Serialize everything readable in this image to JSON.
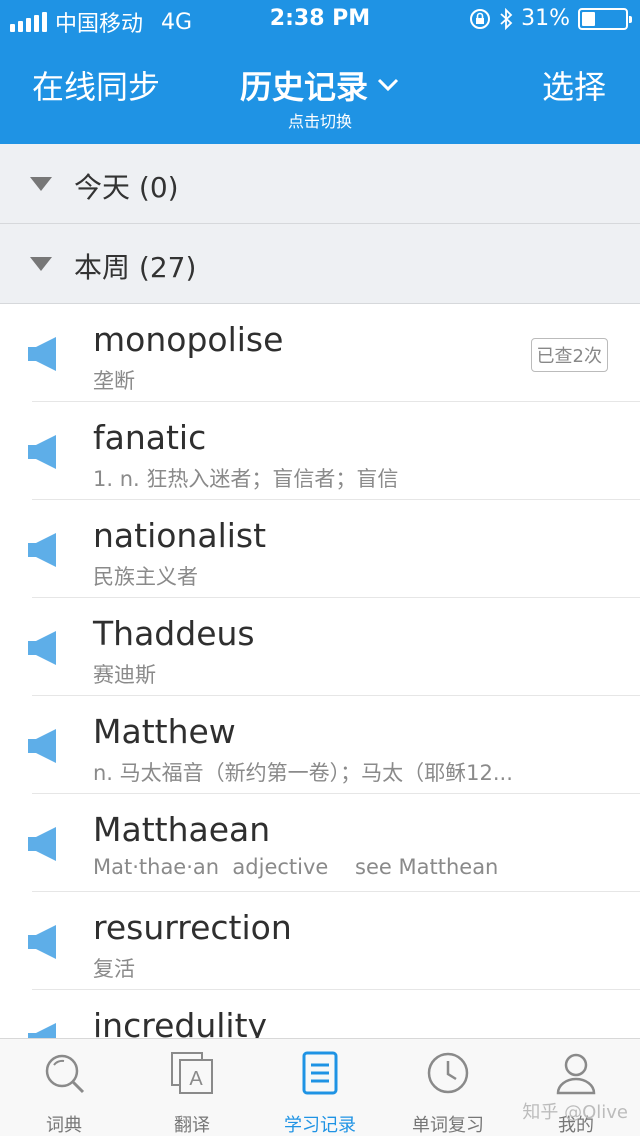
{
  "status": {
    "carrier": "中国移动",
    "network": "4G",
    "time": "2:38 PM",
    "battery_text": "31%",
    "battery_level": 0.31
  },
  "nav": {
    "left": "在线同步",
    "title": "历史记录",
    "subtitle": "点击切换",
    "right": "选择"
  },
  "sections": {
    "today": "今天 (0)",
    "week": "本周 (27)"
  },
  "entries": [
    {
      "word": "monopolise",
      "def": "垄断",
      "badge": "已查2次"
    },
    {
      "word": "fanatic",
      "def": "1. n. 狂热入迷者；盲信者；盲信"
    },
    {
      "word": "nationalist",
      "def": "民族主义者"
    },
    {
      "word": "Thaddeus",
      "def": "赛迪斯"
    },
    {
      "word": "Matthew",
      "def": "n. 马太福音（新约第一卷）；马太（耶稣12..."
    },
    {
      "word": "Matthaean",
      "def": "Mat·thae·an  adjective    see Matthean"
    },
    {
      "word": "resurrection",
      "def": "复活"
    },
    {
      "word": "incredulity",
      "def": ""
    }
  ],
  "tabs": [
    {
      "label": "词典",
      "icon": "search-icon"
    },
    {
      "label": "翻译",
      "icon": "translate-icon"
    },
    {
      "label": "学习记录",
      "icon": "document-icon"
    },
    {
      "label": "单词复习",
      "icon": "clock-icon"
    },
    {
      "label": "我的",
      "icon": "person-icon"
    }
  ],
  "watermark": "知乎 @Olive",
  "colors": {
    "brand": "#1f93e4",
    "section_bg": "#eef0f3",
    "speaker": "#5eaee8"
  }
}
